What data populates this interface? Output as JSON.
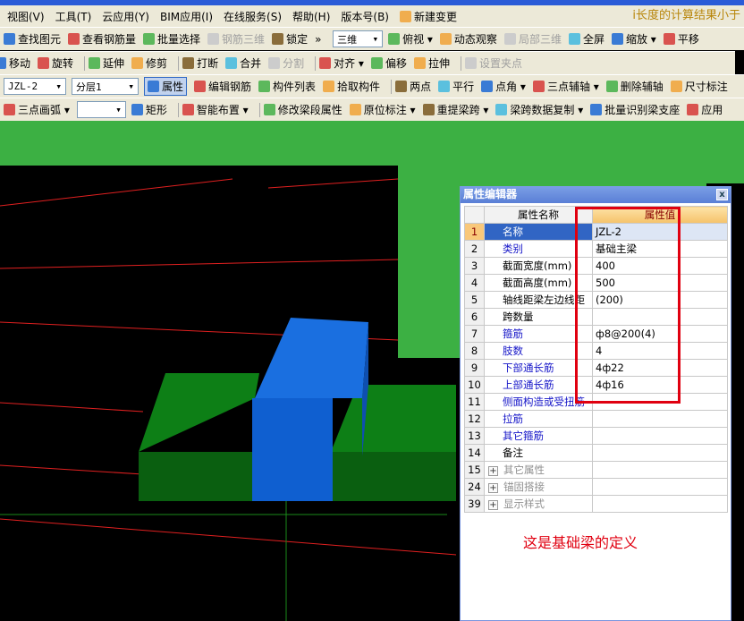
{
  "menu": [
    "视图(V)",
    "工具(T)",
    "云应用(Y)",
    "BIM应用(I)",
    "在线服务(S)",
    "帮助(H)",
    "版本号(B)"
  ],
  "menu_extra": "新建变更",
  "right_title": "i长度的计算结果小于",
  "toolbar1": {
    "left": [
      {
        "label": "查找图元",
        "dis": false
      },
      {
        "label": "查看钢筋量",
        "dis": false
      },
      {
        "label": "批量选择",
        "dis": false
      },
      {
        "label": "钢筋三维",
        "dis": true
      },
      {
        "label": "锁定",
        "dis": false
      }
    ],
    "view_select": "三维",
    "right": [
      {
        "label": "俯视 ▾",
        "dis": false
      },
      {
        "label": "动态观察",
        "dis": false
      },
      {
        "label": "局部三维",
        "dis": true
      },
      {
        "label": "全屏",
        "dis": false
      },
      {
        "label": "缩放 ▾",
        "dis": false
      },
      {
        "label": "平移",
        "dis": false
      }
    ]
  },
  "toolbar2": [
    {
      "label": "移动",
      "dis": false
    },
    {
      "label": "旋转",
      "dis": false
    },
    {
      "label": "延伸",
      "dis": false
    },
    {
      "label": "修剪",
      "dis": false
    },
    {
      "label": "打断",
      "dis": false
    },
    {
      "label": "合并",
      "dis": false
    },
    {
      "label": "分割",
      "dis": true
    },
    {
      "label": "对齐 ▾",
      "dis": false
    },
    {
      "label": "偏移",
      "dis": false
    },
    {
      "label": "拉伸",
      "dis": false
    },
    {
      "label": "设置夹点",
      "dis": true
    }
  ],
  "toolbar3": {
    "component": "JZL-2",
    "layer": "分层1",
    "items": [
      "属性",
      "编辑钢筋",
      "构件列表",
      "拾取构件",
      "两点",
      "平行",
      "点角 ▾",
      "三点辅轴 ▾",
      "删除辅轴",
      "尺寸标注"
    ]
  },
  "toolbar4": {
    "arc": "三点画弧 ▾",
    "arc_value": "",
    "items": [
      "矩形",
      "智能布置 ▾",
      "修改梁段属性",
      "原位标注 ▾",
      "重提梁跨 ▾",
      "梁跨数据复制 ▾",
      "批量识别梁支座",
      "应用"
    ]
  },
  "panel": {
    "title": "属性编辑器",
    "close": "x",
    "col_name": "属性名称",
    "col_value": "属性值",
    "rows": [
      {
        "i": "1",
        "name": "名称",
        "value": "JZL-2",
        "style": "act"
      },
      {
        "i": "2",
        "name": "类别",
        "value": "基础主梁",
        "style": "blue"
      },
      {
        "i": "3",
        "name": "截面宽度(mm)",
        "value": "400",
        "style": ""
      },
      {
        "i": "4",
        "name": "截面高度(mm)",
        "value": "500",
        "style": ""
      },
      {
        "i": "5",
        "name": "轴线距梁左边线距",
        "value": "(200)",
        "style": ""
      },
      {
        "i": "6",
        "name": "跨数量",
        "value": "",
        "style": ""
      },
      {
        "i": "7",
        "name": "箍筋",
        "value": "ф8@200(4)",
        "style": "blue"
      },
      {
        "i": "8",
        "name": "肢数",
        "value": "4",
        "style": "blue"
      },
      {
        "i": "9",
        "name": "下部通长筋",
        "value": "4ф22",
        "style": "blue"
      },
      {
        "i": "10",
        "name": "上部通长筋",
        "value": "4ф16",
        "style": "blue"
      },
      {
        "i": "11",
        "name": "侧面构造或受扭筋",
        "value": "",
        "style": "blue"
      },
      {
        "i": "12",
        "name": "拉筋",
        "value": "",
        "style": "blue"
      },
      {
        "i": "13",
        "name": "其它箍筋",
        "value": "",
        "style": "blue"
      },
      {
        "i": "14",
        "name": "备注",
        "value": "",
        "style": ""
      },
      {
        "i": "15",
        "name": "其它属性",
        "value": "",
        "style": "gray"
      },
      {
        "i": "24",
        "name": "锚固搭接",
        "value": "",
        "style": "gray"
      },
      {
        "i": "39",
        "name": "显示样式",
        "value": "",
        "style": "gray"
      }
    ]
  },
  "annotation": "这是基础梁的定义",
  "colors": {
    "green": "#3cb043",
    "dark_green": "#0a7a14",
    "blue": "#1a6fe0",
    "highlight": "#e00010"
  }
}
